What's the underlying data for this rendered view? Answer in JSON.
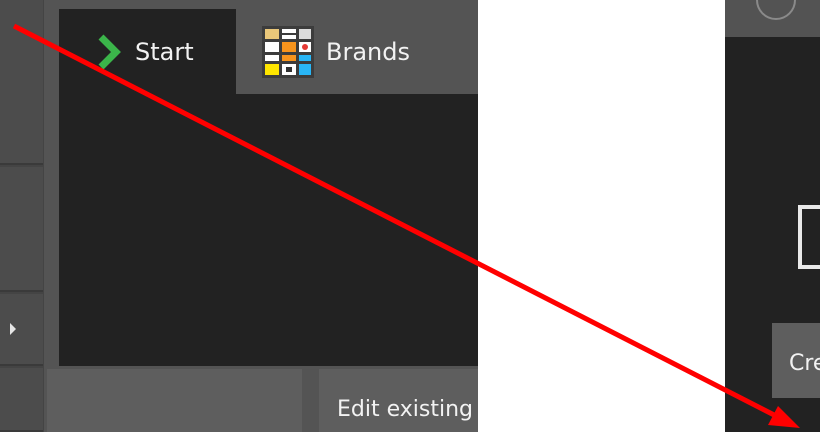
{
  "tabs": [
    {
      "label": "Start",
      "icon": "chevron-right-icon",
      "active": true
    },
    {
      "label": "Brands",
      "icon": "brands-grid-icon",
      "active": false
    }
  ],
  "tiles": {
    "edit_existing": "Edit existing",
    "create": "Create"
  },
  "colors": {
    "annotation_arrow": "#ff0000",
    "chevron": "#3bb54a",
    "panel_dark": "#222222",
    "panel_mid": "#545454"
  }
}
